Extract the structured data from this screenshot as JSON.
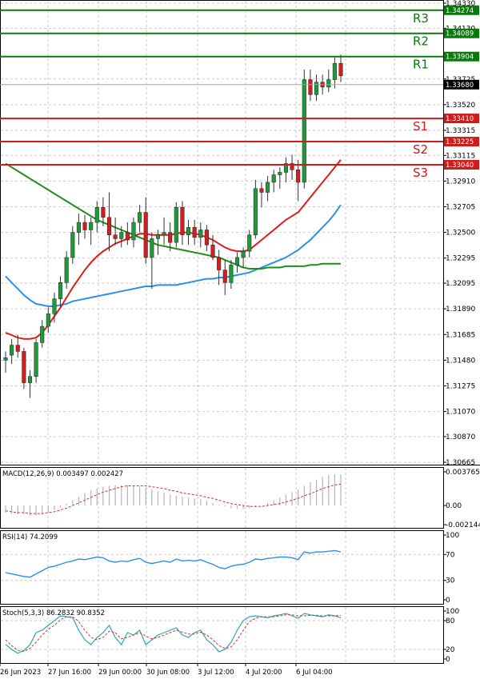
{
  "chart_data": {
    "type": "candlestick",
    "main": {
      "price_axis_labels": [
        "1.34330",
        "1.34130",
        "1.33725",
        "1.33520",
        "1.33315",
        "1.33115",
        "1.32910",
        "1.32705",
        "1.32500",
        "1.32295",
        "1.32095",
        "1.31890",
        "1.31685",
        "1.31480",
        "1.31275",
        "1.31070",
        "1.30870",
        "1.30665"
      ],
      "current_price": "1.33680",
      "levels": [
        {
          "name": "R3",
          "value": "1.34274",
          "kind": "resistance"
        },
        {
          "name": "R2",
          "value": "1.34089",
          "kind": "resistance"
        },
        {
          "name": "R1",
          "value": "1.33904",
          "kind": "resistance"
        },
        {
          "name": "S1",
          "value": "1.33410",
          "kind": "support"
        },
        {
          "name": "S2",
          "value": "1.33225",
          "kind": "support"
        },
        {
          "name": "S3",
          "value": "1.33040",
          "kind": "support"
        }
      ],
      "ylim": [
        1.30665,
        1.3433
      ],
      "candles": [
        [
          1.3148,
          1.3155,
          1.3138,
          1.315
        ],
        [
          1.3152,
          1.3165,
          1.3145,
          1.316
        ],
        [
          1.316,
          1.3168,
          1.315,
          1.3155
        ],
        [
          1.3155,
          1.3158,
          1.3125,
          1.313
        ],
        [
          1.313,
          1.314,
          1.3118,
          1.3135
        ],
        [
          1.3135,
          1.3165,
          1.313,
          1.3162
        ],
        [
          1.3162,
          1.318,
          1.3158,
          1.3175
        ],
        [
          1.3175,
          1.319,
          1.317,
          1.3185
        ],
        [
          1.3185,
          1.3202,
          1.3178,
          1.3197
        ],
        [
          1.3197,
          1.3215,
          1.319,
          1.321
        ],
        [
          1.321,
          1.3235,
          1.3205,
          1.323
        ],
        [
          1.323,
          1.3255,
          1.3225,
          1.325
        ],
        [
          1.325,
          1.3265,
          1.324,
          1.3258
        ],
        [
          1.3258,
          1.3264,
          1.3245,
          1.3252
        ],
        [
          1.3252,
          1.3262,
          1.324,
          1.3258
        ],
        [
          1.3258,
          1.3275,
          1.325,
          1.327
        ],
        [
          1.327,
          1.3278,
          1.3255,
          1.3262
        ],
        [
          1.3262,
          1.3282,
          1.3235,
          1.3248
        ],
        [
          1.3248,
          1.3262,
          1.324,
          1.3245
        ],
        [
          1.3245,
          1.3255,
          1.3238,
          1.325
        ],
        [
          1.325,
          1.3258,
          1.324,
          1.3244
        ],
        [
          1.3244,
          1.3262,
          1.3238,
          1.3258
        ],
        [
          1.3258,
          1.3272,
          1.325,
          1.3266
        ],
        [
          1.3266,
          1.3278,
          1.3225,
          1.323
        ],
        [
          1.323,
          1.325,
          1.3205,
          1.3245
        ],
        [
          1.3245,
          1.3252,
          1.3232,
          1.3248
        ],
        [
          1.3248,
          1.3262,
          1.324,
          1.325
        ],
        [
          1.325,
          1.3258,
          1.3235,
          1.3242
        ],
        [
          1.3242,
          1.3274,
          1.3238,
          1.327
        ],
        [
          1.327,
          1.3275,
          1.324,
          1.3248
        ],
        [
          1.3248,
          1.326,
          1.324,
          1.3254
        ],
        [
          1.3254,
          1.326,
          1.324,
          1.3246
        ],
        [
          1.3246,
          1.3258,
          1.3238,
          1.3252
        ],
        [
          1.3252,
          1.3256,
          1.3235,
          1.324
        ],
        [
          1.324,
          1.3248,
          1.3228,
          1.323
        ],
        [
          1.323,
          1.3236,
          1.3208,
          1.322
        ],
        [
          1.322,
          1.3228,
          1.32,
          1.321
        ],
        [
          1.321,
          1.3228,
          1.3205,
          1.3224
        ],
        [
          1.3224,
          1.3234,
          1.3218,
          1.323
        ],
        [
          1.323,
          1.3238,
          1.3222,
          1.3235
        ],
        [
          1.3235,
          1.3252,
          1.323,
          1.3248
        ],
        [
          1.3248,
          1.3292,
          1.3245,
          1.3285
        ],
        [
          1.3285,
          1.329,
          1.327,
          1.3282
        ],
        [
          1.3282,
          1.3295,
          1.3275,
          1.329
        ],
        [
          1.329,
          1.33,
          1.3282,
          1.3296
        ],
        [
          1.3296,
          1.3302,
          1.3285,
          1.3298
        ],
        [
          1.3298,
          1.331,
          1.329,
          1.3305
        ],
        [
          1.3305,
          1.3312,
          1.3292,
          1.33
        ],
        [
          1.33,
          1.3308,
          1.3275,
          1.329
        ],
        [
          1.329,
          1.338,
          1.3285,
          1.3372
        ],
        [
          1.3372,
          1.338,
          1.3355,
          1.336
        ],
        [
          1.336,
          1.3376,
          1.3355,
          1.337
        ],
        [
          1.337,
          1.3376,
          1.336,
          1.3366
        ],
        [
          1.3366,
          1.338,
          1.3362,
          1.3372
        ],
        [
          1.3372,
          1.339,
          1.3365,
          1.3385
        ],
        [
          1.3385,
          1.3392,
          1.337,
          1.3375
        ]
      ],
      "ma_green": [
        1.3305,
        1.3302,
        1.3299,
        1.3296,
        1.3293,
        1.329,
        1.3287,
        1.3284,
        1.3281,
        1.3278,
        1.3275,
        1.3272,
        1.3269,
        1.3266,
        1.3263,
        1.326,
        1.3258,
        1.3256,
        1.3254,
        1.3252,
        1.325,
        1.3248,
        1.3246,
        1.3244,
        1.3242,
        1.324,
        1.3239,
        1.3238,
        1.3237,
        1.3236,
        1.3235,
        1.3234,
        1.3233,
        1.3232,
        1.3231,
        1.323,
        1.3228,
        1.3226,
        1.3224,
        1.3222,
        1.3221,
        1.3221,
        1.3221,
        1.3222,
        1.3222,
        1.3222,
        1.3223,
        1.3223,
        1.3223,
        1.3223,
        1.3224,
        1.3224,
        1.3225,
        1.3225,
        1.3225,
        1.3225
      ],
      "ma_red": [
        1.317,
        1.3168,
        1.3166,
        1.3165,
        1.3165,
        1.3166,
        1.317,
        1.3176,
        1.3183,
        1.319,
        1.3198,
        1.3206,
        1.3213,
        1.322,
        1.3226,
        1.3231,
        1.3235,
        1.3238,
        1.3241,
        1.3243,
        1.3245,
        1.3247,
        1.3249,
        1.3249,
        1.3248,
        1.3248,
        1.3248,
        1.3248,
        1.3249,
        1.325,
        1.325,
        1.3249,
        1.3248,
        1.3246,
        1.3244,
        1.3241,
        1.3238,
        1.3236,
        1.3235,
        1.3235,
        1.3236,
        1.324,
        1.3244,
        1.3248,
        1.3252,
        1.3256,
        1.326,
        1.3263,
        1.3266,
        1.3272,
        1.3278,
        1.3284,
        1.329,
        1.3296,
        1.3302,
        1.3308
      ],
      "ma_blue": [
        1.3215,
        1.321,
        1.3205,
        1.32,
        1.3196,
        1.3193,
        1.3192,
        1.3191,
        1.3191,
        1.3192,
        1.3193,
        1.3195,
        1.3196,
        1.3197,
        1.3198,
        1.3199,
        1.32,
        1.3201,
        1.3202,
        1.3203,
        1.3204,
        1.3205,
        1.3206,
        1.3207,
        1.3207,
        1.3208,
        1.3208,
        1.3208,
        1.3208,
        1.3209,
        1.321,
        1.3211,
        1.3212,
        1.3213,
        1.3213,
        1.3214,
        1.3214,
        1.3215,
        1.3216,
        1.3217,
        1.3218,
        1.322,
        1.3222,
        1.3224,
        1.3226,
        1.3228,
        1.323,
        1.3233,
        1.3236,
        1.324,
        1.3244,
        1.3249,
        1.3254,
        1.3259,
        1.3265,
        1.3272
      ]
    },
    "macd": {
      "title": "MACD(12,26,9) 0.003497 0.002427",
      "axis_labels": [
        "0.003765",
        "0.00",
        "-0.002144"
      ],
      "ylim": [
        -0.002144,
        0.003765
      ],
      "histogram": [
        -0.0008,
        -0.0009,
        -0.001,
        -0.001,
        -0.0011,
        -0.0011,
        -0.001,
        -0.0008,
        -0.0005,
        -0.0002,
        0.0002,
        0.0006,
        0.001,
        0.0014,
        0.0017,
        0.0019,
        0.0021,
        0.0022,
        0.0023,
        0.0023,
        0.0023,
        0.0022,
        0.0021,
        0.002,
        0.0018,
        0.0016,
        0.0014,
        0.0012,
        0.0011,
        0.001,
        0.0009,
        0.0008,
        0.0007,
        0.0005,
        0.0003,
        0.0001,
        -0.0001,
        -0.0003,
        -0.0004,
        -0.0004,
        -0.0003,
        -0.0002,
        0.0,
        0.0003,
        0.0006,
        0.0009,
        0.0012,
        0.0015,
        0.0018,
        0.0022,
        0.0026,
        0.0029,
        0.0032,
        0.0034,
        0.0035,
        0.0035
      ],
      "signal": [
        -0.0006,
        -0.0007,
        -0.0008,
        -0.0008,
        -0.0009,
        -0.0009,
        -0.0009,
        -0.0008,
        -0.0007,
        -0.0005,
        -0.0003,
        0.0,
        0.0003,
        0.0006,
        0.0009,
        0.0012,
        0.0015,
        0.0017,
        0.0019,
        0.0021,
        0.0022,
        0.0022,
        0.0022,
        0.0022,
        0.0021,
        0.002,
        0.0019,
        0.0017,
        0.0016,
        0.0014,
        0.0013,
        0.0012,
        0.0011,
        0.0009,
        0.0008,
        0.0006,
        0.0004,
        0.0002,
        0.0001,
        0.0,
        -0.0001,
        -0.0001,
        -0.0001,
        0.0,
        0.0001,
        0.0002,
        0.0004,
        0.0006,
        0.0008,
        0.0011,
        0.0013,
        0.0016,
        0.0019,
        0.0021,
        0.0023,
        0.0024
      ]
    },
    "rsi": {
      "title": "RSI(14) 74.2099",
      "axis_labels": [
        "100",
        "70",
        "30",
        "0"
      ],
      "ylim": [
        0,
        100
      ],
      "values": [
        42,
        40,
        38,
        36,
        35,
        40,
        45,
        50,
        52,
        55,
        58,
        60,
        63,
        62,
        64,
        66,
        65,
        60,
        58,
        60,
        59,
        62,
        64,
        58,
        56,
        58,
        60,
        58,
        63,
        60,
        61,
        60,
        62,
        58,
        55,
        50,
        48,
        52,
        54,
        55,
        58,
        63,
        62,
        64,
        65,
        66,
        66,
        65,
        62,
        74,
        72,
        74,
        74,
        75,
        76,
        74
      ]
    },
    "stoch": {
      "title": "Stoch(5,3,3) 86.2832 90.8352",
      "axis_labels": [
        "100",
        "80",
        "20",
        "0"
      ],
      "ylim": [
        0,
        100
      ],
      "k": [
        30,
        20,
        12,
        18,
        30,
        55,
        60,
        70,
        80,
        90,
        88,
        86,
        60,
        40,
        30,
        45,
        55,
        70,
        45,
        30,
        55,
        50,
        60,
        30,
        40,
        50,
        55,
        60,
        65,
        50,
        45,
        55,
        60,
        40,
        30,
        15,
        20,
        35,
        60,
        80,
        88,
        90,
        88,
        86,
        90,
        92,
        95,
        90,
        85,
        95,
        92,
        90,
        88,
        92,
        90,
        86
      ],
      "d": [
        40,
        28,
        18,
        16,
        22,
        35,
        50,
        62,
        70,
        82,
        88,
        88,
        78,
        60,
        45,
        40,
        45,
        58,
        55,
        42,
        45,
        50,
        55,
        48,
        42,
        45,
        50,
        55,
        60,
        56,
        52,
        52,
        56,
        50,
        40,
        28,
        22,
        25,
        40,
        60,
        78,
        85,
        88,
        88,
        88,
        90,
        92,
        92,
        90,
        90,
        91,
        91,
        90,
        90,
        90,
        91
      ]
    },
    "x_tick_labels": [
      "26 Jun 2023",
      "27 Jun 16:00",
      "29 Jun 00:00",
      "30 Jun 08:00",
      "3 Jul 12:00",
      "4 Jul 20:00",
      "6 Jul 04:00"
    ],
    "colors": {
      "bull": "#1f9a3a",
      "bear": "#d21e1e",
      "resistance": "#0a7a0a",
      "support": "#d11a1a",
      "ma_green": "#1c8f1c",
      "ma_red": "#e01b1b",
      "ma_blue": "#2c8fe8",
      "grid": "#c9c9c9",
      "rsi": "#2c8fe8",
      "stoch_k": "#2aa7b8",
      "stoch_d": "#d93030",
      "macd_hist": "#b5b5b5",
      "macd_signal": "#d93030"
    }
  }
}
